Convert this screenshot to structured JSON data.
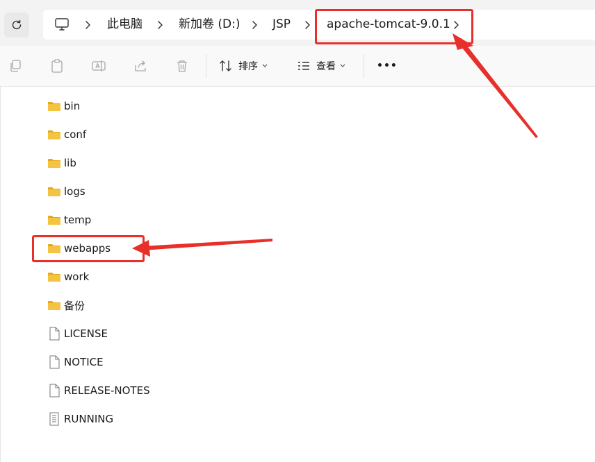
{
  "breadcrumb": {
    "items": [
      {
        "label": "此电脑"
      },
      {
        "label": "新加卷 (D:)"
      },
      {
        "label": "JSP"
      },
      {
        "label": "apache-tomcat-9.0.1"
      }
    ]
  },
  "toolbar": {
    "sort_label": "排序",
    "view_label": "查看",
    "more_label": "•••"
  },
  "files": [
    {
      "name": "bin",
      "type": "folder"
    },
    {
      "name": "conf",
      "type": "folder"
    },
    {
      "name": "lib",
      "type": "folder"
    },
    {
      "name": "logs",
      "type": "folder"
    },
    {
      "name": "temp",
      "type": "folder"
    },
    {
      "name": "webapps",
      "type": "folder"
    },
    {
      "name": "work",
      "type": "folder"
    },
    {
      "name": "备份",
      "type": "folder"
    },
    {
      "name": "LICENSE",
      "type": "file"
    },
    {
      "name": "NOTICE",
      "type": "file"
    },
    {
      "name": "RELEASE-NOTES",
      "type": "file"
    },
    {
      "name": "RUNNING",
      "type": "text-file"
    }
  ],
  "colors": {
    "annotation": "#e8302a",
    "folder": "#f5c342",
    "folder_dark": "#e6a817"
  }
}
